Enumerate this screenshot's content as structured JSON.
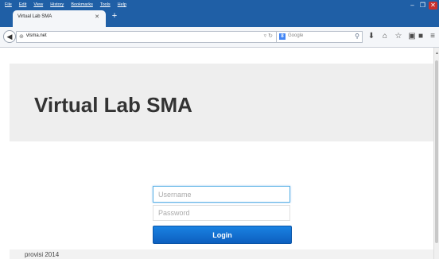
{
  "browser": {
    "menu": [
      "File",
      "Edit",
      "View",
      "History",
      "Bookmarks",
      "Tools",
      "Help"
    ],
    "tab": {
      "title": "Virtual Lab SMA"
    },
    "url": "vlsma.net",
    "search": {
      "engine": "8",
      "placeholder": "Google"
    }
  },
  "page": {
    "hero_title": "Virtual Lab SMA",
    "form": {
      "username_placeholder": "Username",
      "password_placeholder": "Password",
      "login_label": "Login"
    },
    "footer": "provisi 2014"
  }
}
